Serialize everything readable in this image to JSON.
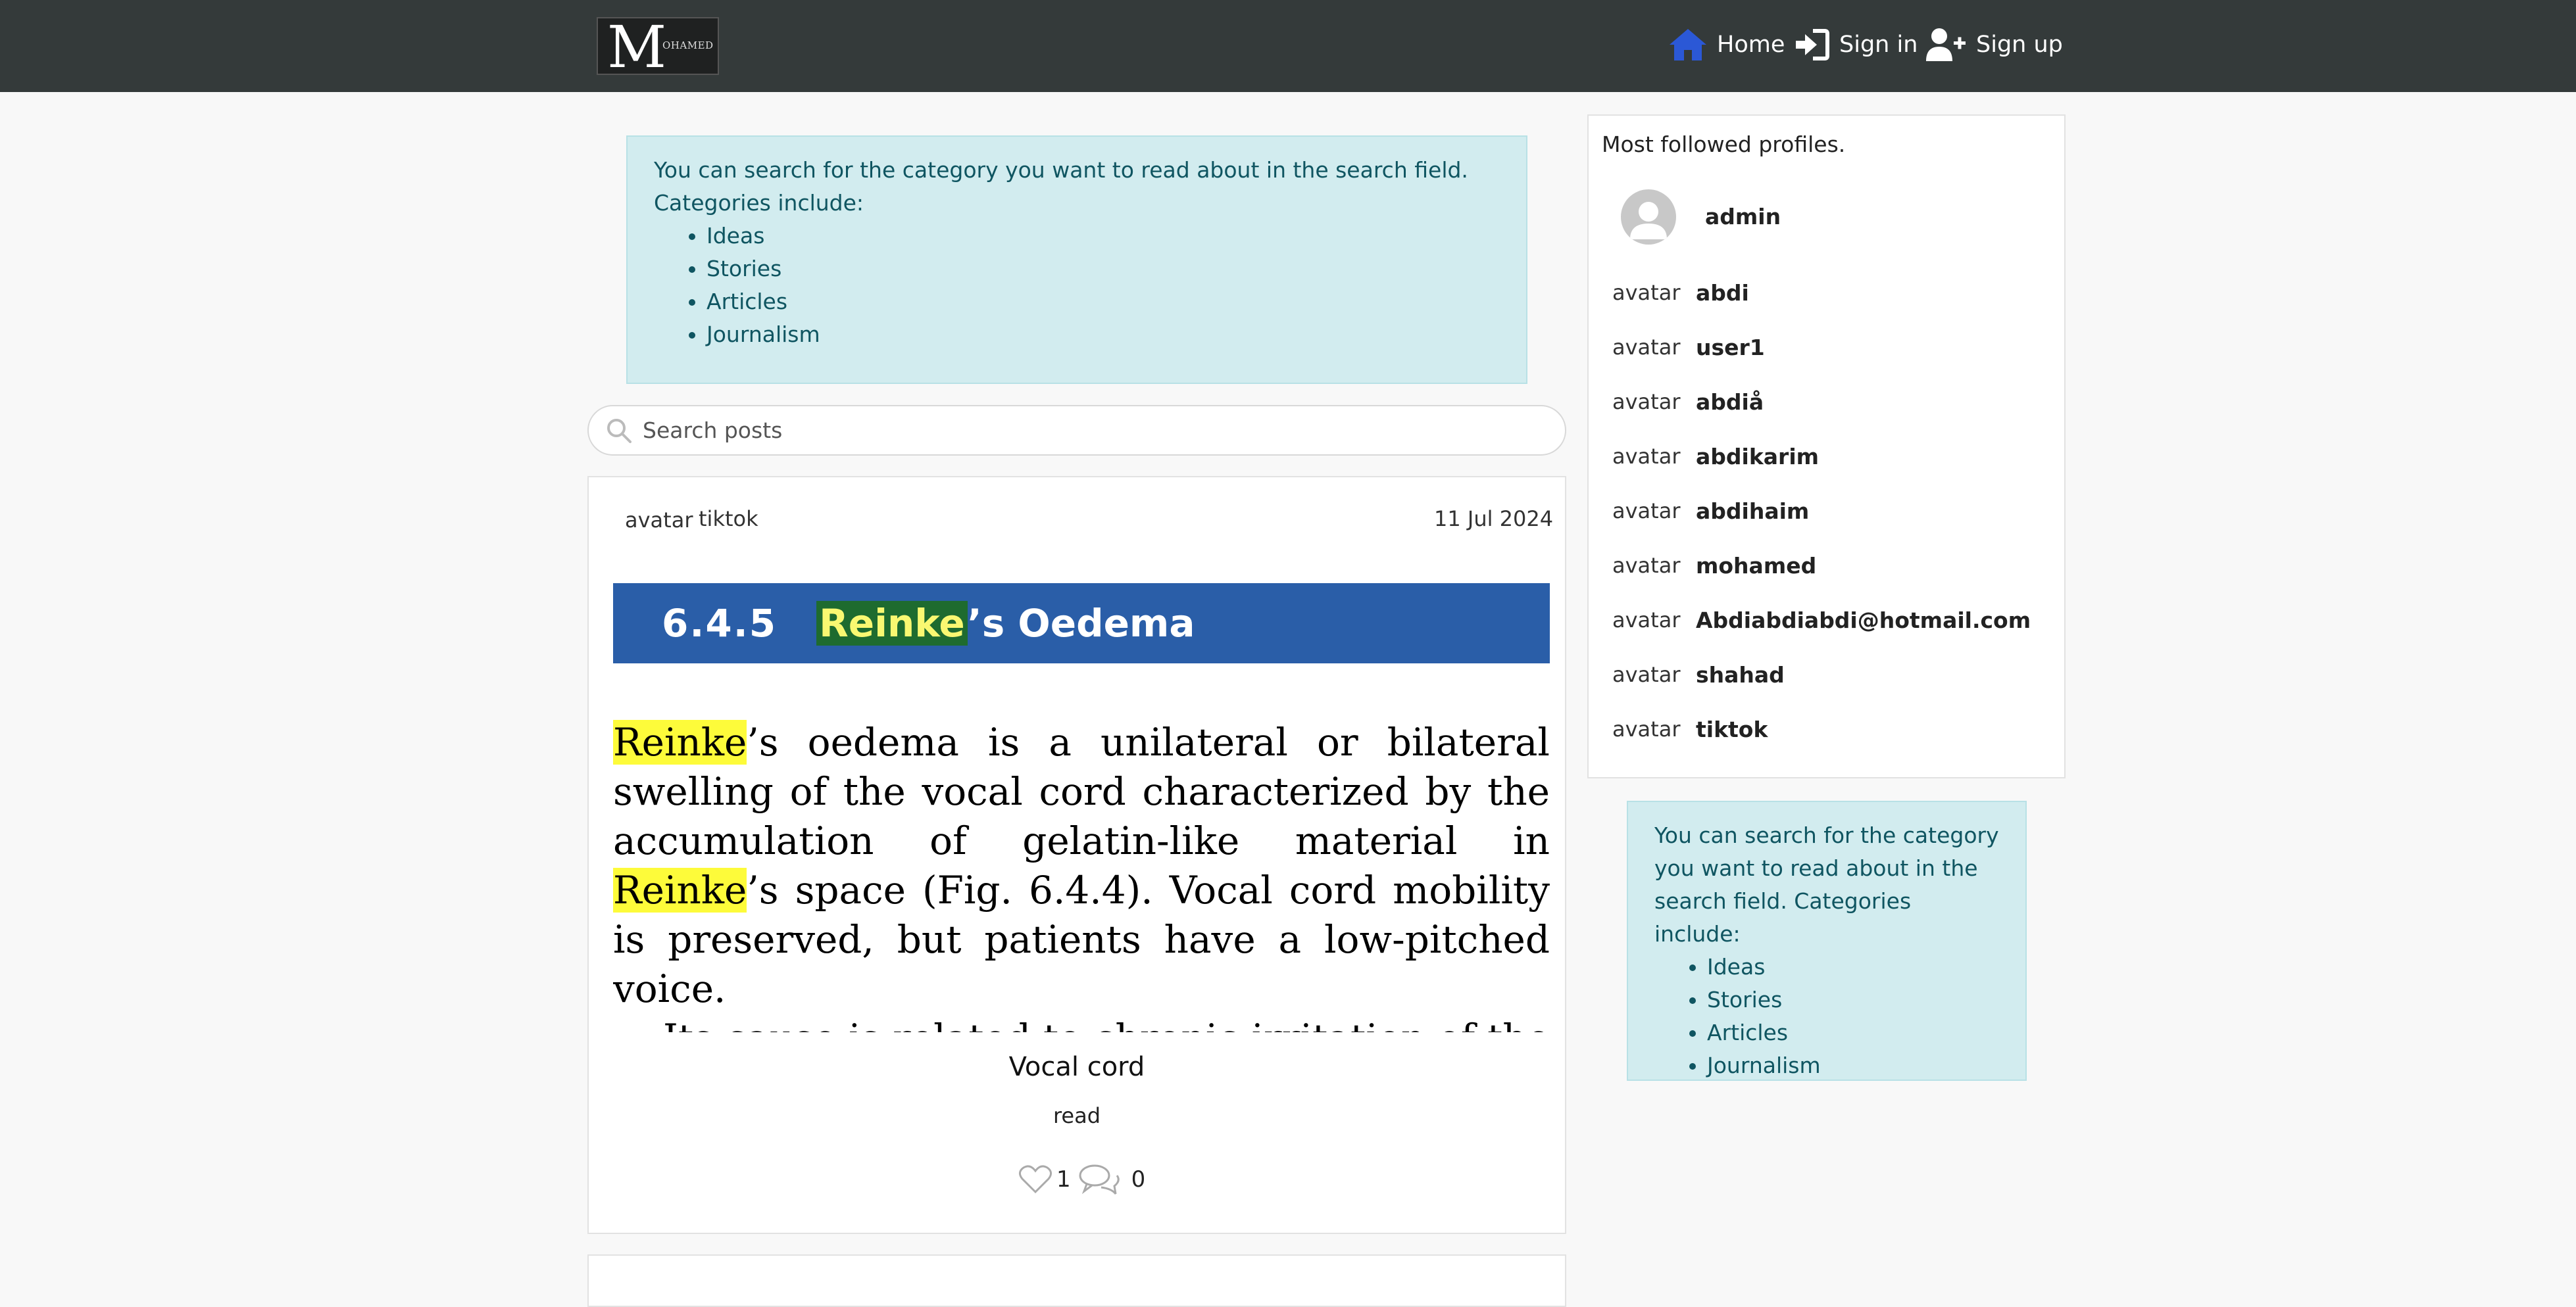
{
  "nav": {
    "logo_letter": "M",
    "logo_text": "OHAMED",
    "home": "Home",
    "sign_in": "Sign in",
    "sign_up": "Sign up",
    "colors": {
      "bar": "#343a3a",
      "home_icon": "#2b58d6"
    }
  },
  "info_alert": {
    "text": "You can search for the category you want to read about in the search field.",
    "categories_label": "Categories include:",
    "categories": [
      "Ideas",
      "Stories",
      "Articles",
      "Journalism"
    ]
  },
  "side_alert": {
    "text": "You can search for the category you want to read about in the search field. Categories include:",
    "categories": [
      "Ideas",
      "Stories",
      "Articles",
      "Journalism"
    ]
  },
  "search": {
    "placeholder": "Search posts",
    "icon": "search-icon"
  },
  "post": {
    "avatar_alt": "avatar",
    "author": "tiktok",
    "date": "11 Jul 2024",
    "banner_number": "6.4.5",
    "banner_highlight": "Reinke",
    "banner_rest": "’s Oedema",
    "excerpt": {
      "hl1": "Reinke",
      "p1a": "’s oedema is a unilateral or bilateral swelling of the vocal cord characterized by the accumulation of gelatin-like material in ",
      "hl2": "Reinke",
      "p1b": "’s space (Fig. 6.4.4). Vocal cord mobility is preserved, but patients have a low-pitched voice.",
      "p2": "Its cause is related to chronic irritation of the larynx leading to oedema, vascular congestion and capillary"
    },
    "title": "Vocal cord",
    "read_label": "read",
    "likes": "1",
    "comments": "0"
  },
  "sidebar": {
    "title": "Most followed profiles.",
    "top_profile": "admin",
    "avatar_alt": "avatar",
    "profiles": [
      "abdi",
      "user1",
      "abdiå",
      "abdikarim",
      "abdihaim",
      "mohamed",
      "Abdiabdiabdi@hotmail.com",
      "shahad",
      "tiktok"
    ]
  }
}
